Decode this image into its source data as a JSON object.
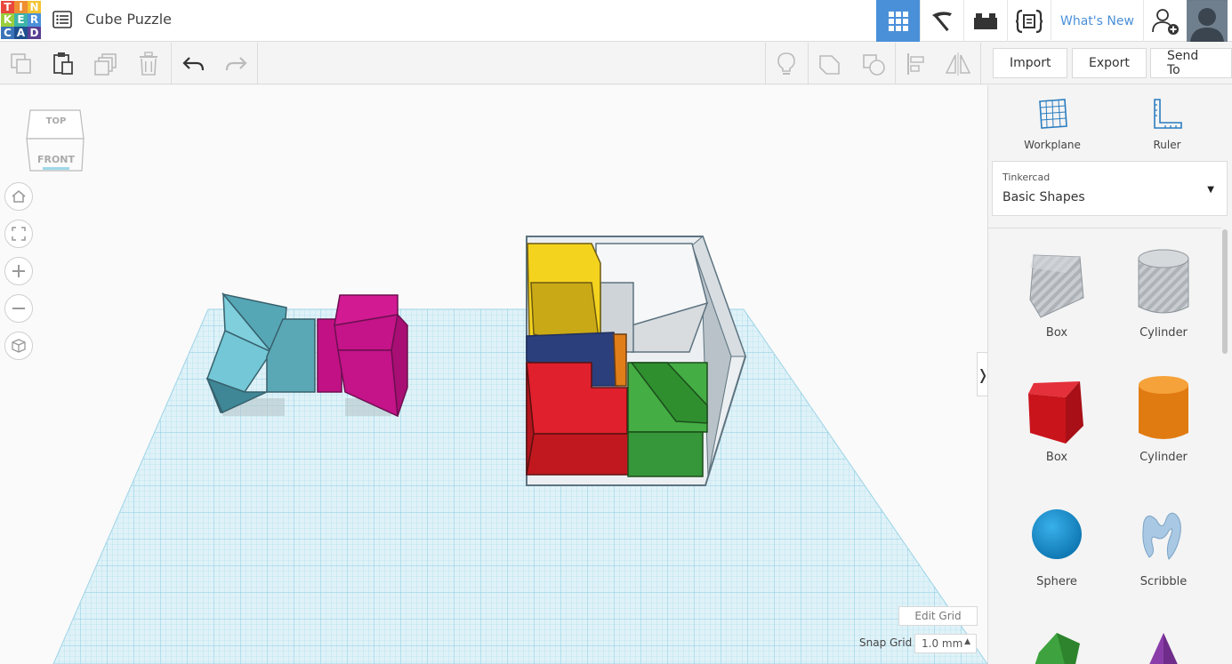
{
  "app": {
    "logo_letters": [
      "T",
      "I",
      "N",
      "K",
      "E",
      "R",
      "C",
      "A",
      "D"
    ],
    "project_title": "Cube Puzzle"
  },
  "topbar": {
    "whats_new": "What's New"
  },
  "toolbar": {
    "import_label": "Import",
    "export_label": "Export",
    "send_to_label": "Send To"
  },
  "viewcube": {
    "top": "TOP",
    "front": "FRONT"
  },
  "viewport": {
    "edit_grid": "Edit Grid",
    "snap_grid_label": "Snap Grid",
    "snap_grid_value": "1.0 mm"
  },
  "panel": {
    "workplane": "Workplane",
    "ruler": "Ruler",
    "library_source": "Tinkercad",
    "library_name": "Basic Shapes",
    "shapes": [
      {
        "label": "Box"
      },
      {
        "label": "Cylinder"
      },
      {
        "label": "Box"
      },
      {
        "label": "Cylinder"
      },
      {
        "label": "Sphere"
      },
      {
        "label": "Scribble"
      }
    ]
  },
  "colors": {
    "accent": "#4a90d9",
    "logo": [
      "#e8483b",
      "#ef8e32",
      "#f4c431",
      "#9acd3c",
      "#3eb4a9",
      "#4a90d9",
      "#3b73b9",
      "#1f4f8f",
      "#5a3e92"
    ]
  }
}
